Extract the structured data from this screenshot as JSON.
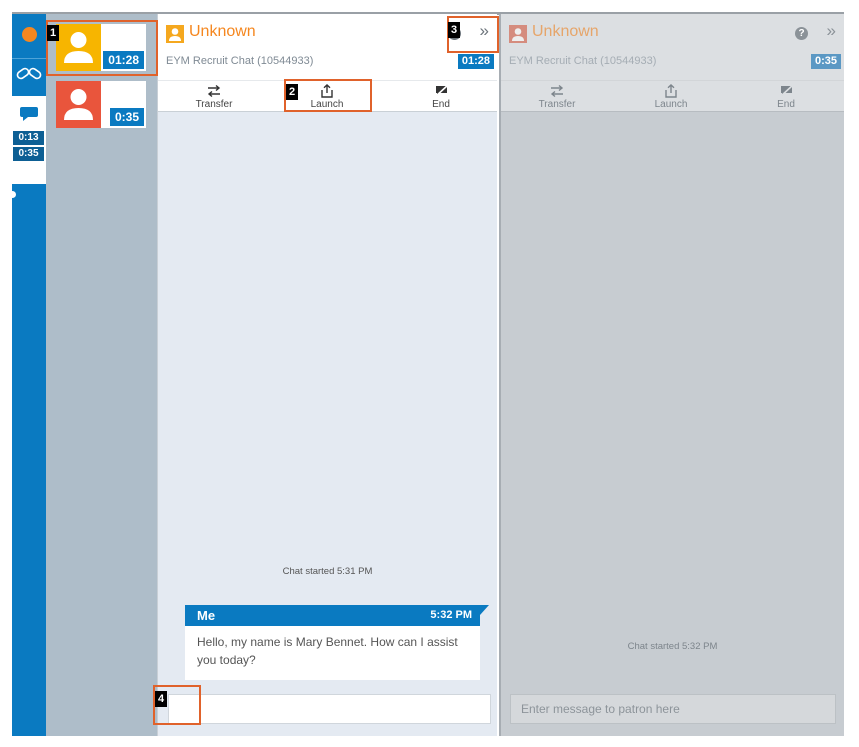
{
  "rail": {
    "badges": [
      "0:13",
      "0:35"
    ]
  },
  "queue": {
    "items": [
      {
        "time": "01:28",
        "avatar_color": "#f7b500",
        "selected": true
      },
      {
        "time": "0:35",
        "avatar_color": "#e9553c",
        "selected": false
      }
    ]
  },
  "annotations": {
    "n1": "1",
    "n2": "2",
    "n3": "3",
    "n4": "4"
  },
  "active_chat": {
    "name": "Unknown",
    "subtitle": "EYM Recruit Chat (10544933)",
    "timer": "01:28",
    "help_glyph": "?",
    "expand_glyph": "»",
    "toolbar": {
      "transfer": "Transfer",
      "launch": "Launch",
      "end": "End"
    },
    "started": "Chat started 5:31 PM",
    "message": {
      "sender": "Me",
      "time": "5:32 PM",
      "text": "Hello, my  name is Mary Bennet. How can I assist you today?"
    },
    "input_placeholder": ""
  },
  "inactive_chat": {
    "name": "Unknown",
    "subtitle": "EYM Recruit Chat (10544933)",
    "timer": "0:35",
    "help_glyph": "?",
    "expand_glyph": "»",
    "toolbar": {
      "transfer": "Transfer",
      "launch": "Launch",
      "end": "End"
    },
    "started": "Chat started 5:32 PM",
    "input_placeholder": "Enter message to patron here"
  },
  "colors": {
    "brand_blue": "#0a7ac1",
    "accent_orange": "#f5871f",
    "highlight": "#e0622b"
  }
}
